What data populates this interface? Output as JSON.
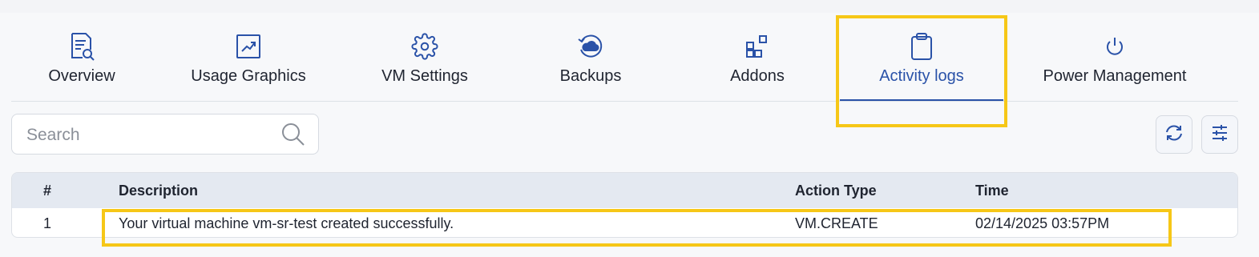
{
  "tabs": [
    {
      "label": "Overview",
      "icon": "document-search-icon"
    },
    {
      "label": "Usage Graphics",
      "icon": "chart-trend-icon"
    },
    {
      "label": "VM Settings",
      "icon": "gear-icon"
    },
    {
      "label": "Backups",
      "icon": "cloud-backup-icon"
    },
    {
      "label": "Addons",
      "icon": "addons-grid-icon"
    },
    {
      "label": "Activity logs",
      "icon": "clipboard-icon"
    },
    {
      "label": "Power Management",
      "icon": "power-icon"
    }
  ],
  "active_tab": "Activity logs",
  "search": {
    "placeholder": "Search",
    "value": ""
  },
  "toolbar": {
    "refresh_icon": "refresh-icon",
    "filter_icon": "sliders-icon"
  },
  "table": {
    "headers": [
      "#",
      "Description",
      "Action Type",
      "Time"
    ],
    "rows": [
      [
        "1",
        "Your virtual machine vm-sr-test created successfully.",
        "VM.CREATE",
        "02/14/2025 03:57PM"
      ]
    ]
  },
  "colors": {
    "accent": "#2a52a8",
    "highlight": "#f6c717",
    "header_bg": "#e4e9f1"
  }
}
